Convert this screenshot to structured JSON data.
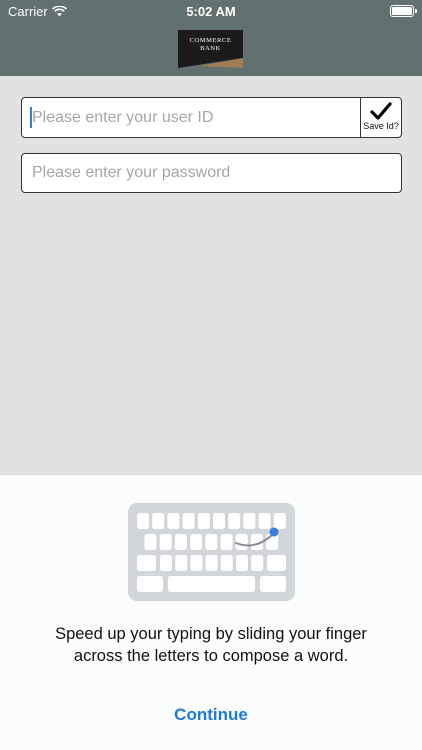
{
  "status_bar": {
    "carrier": "Carrier",
    "time": "5:02 AM"
  },
  "header": {
    "logo_lines": [
      "COMMERCE",
      "BANK"
    ]
  },
  "login_form": {
    "userid_placeholder": "Please enter your user ID",
    "save_id_label": "Save Id?",
    "save_id_checked": true,
    "password_placeholder": "Please enter your password"
  },
  "keyboard_tip": {
    "message": "Speed up your typing by sliding your finger across the letters to compose a word.",
    "continue_label": "Continue"
  },
  "colors": {
    "header_bg": "#60716f",
    "page_bg": "#e2e2e2",
    "link_blue": "#1d7ad9"
  }
}
